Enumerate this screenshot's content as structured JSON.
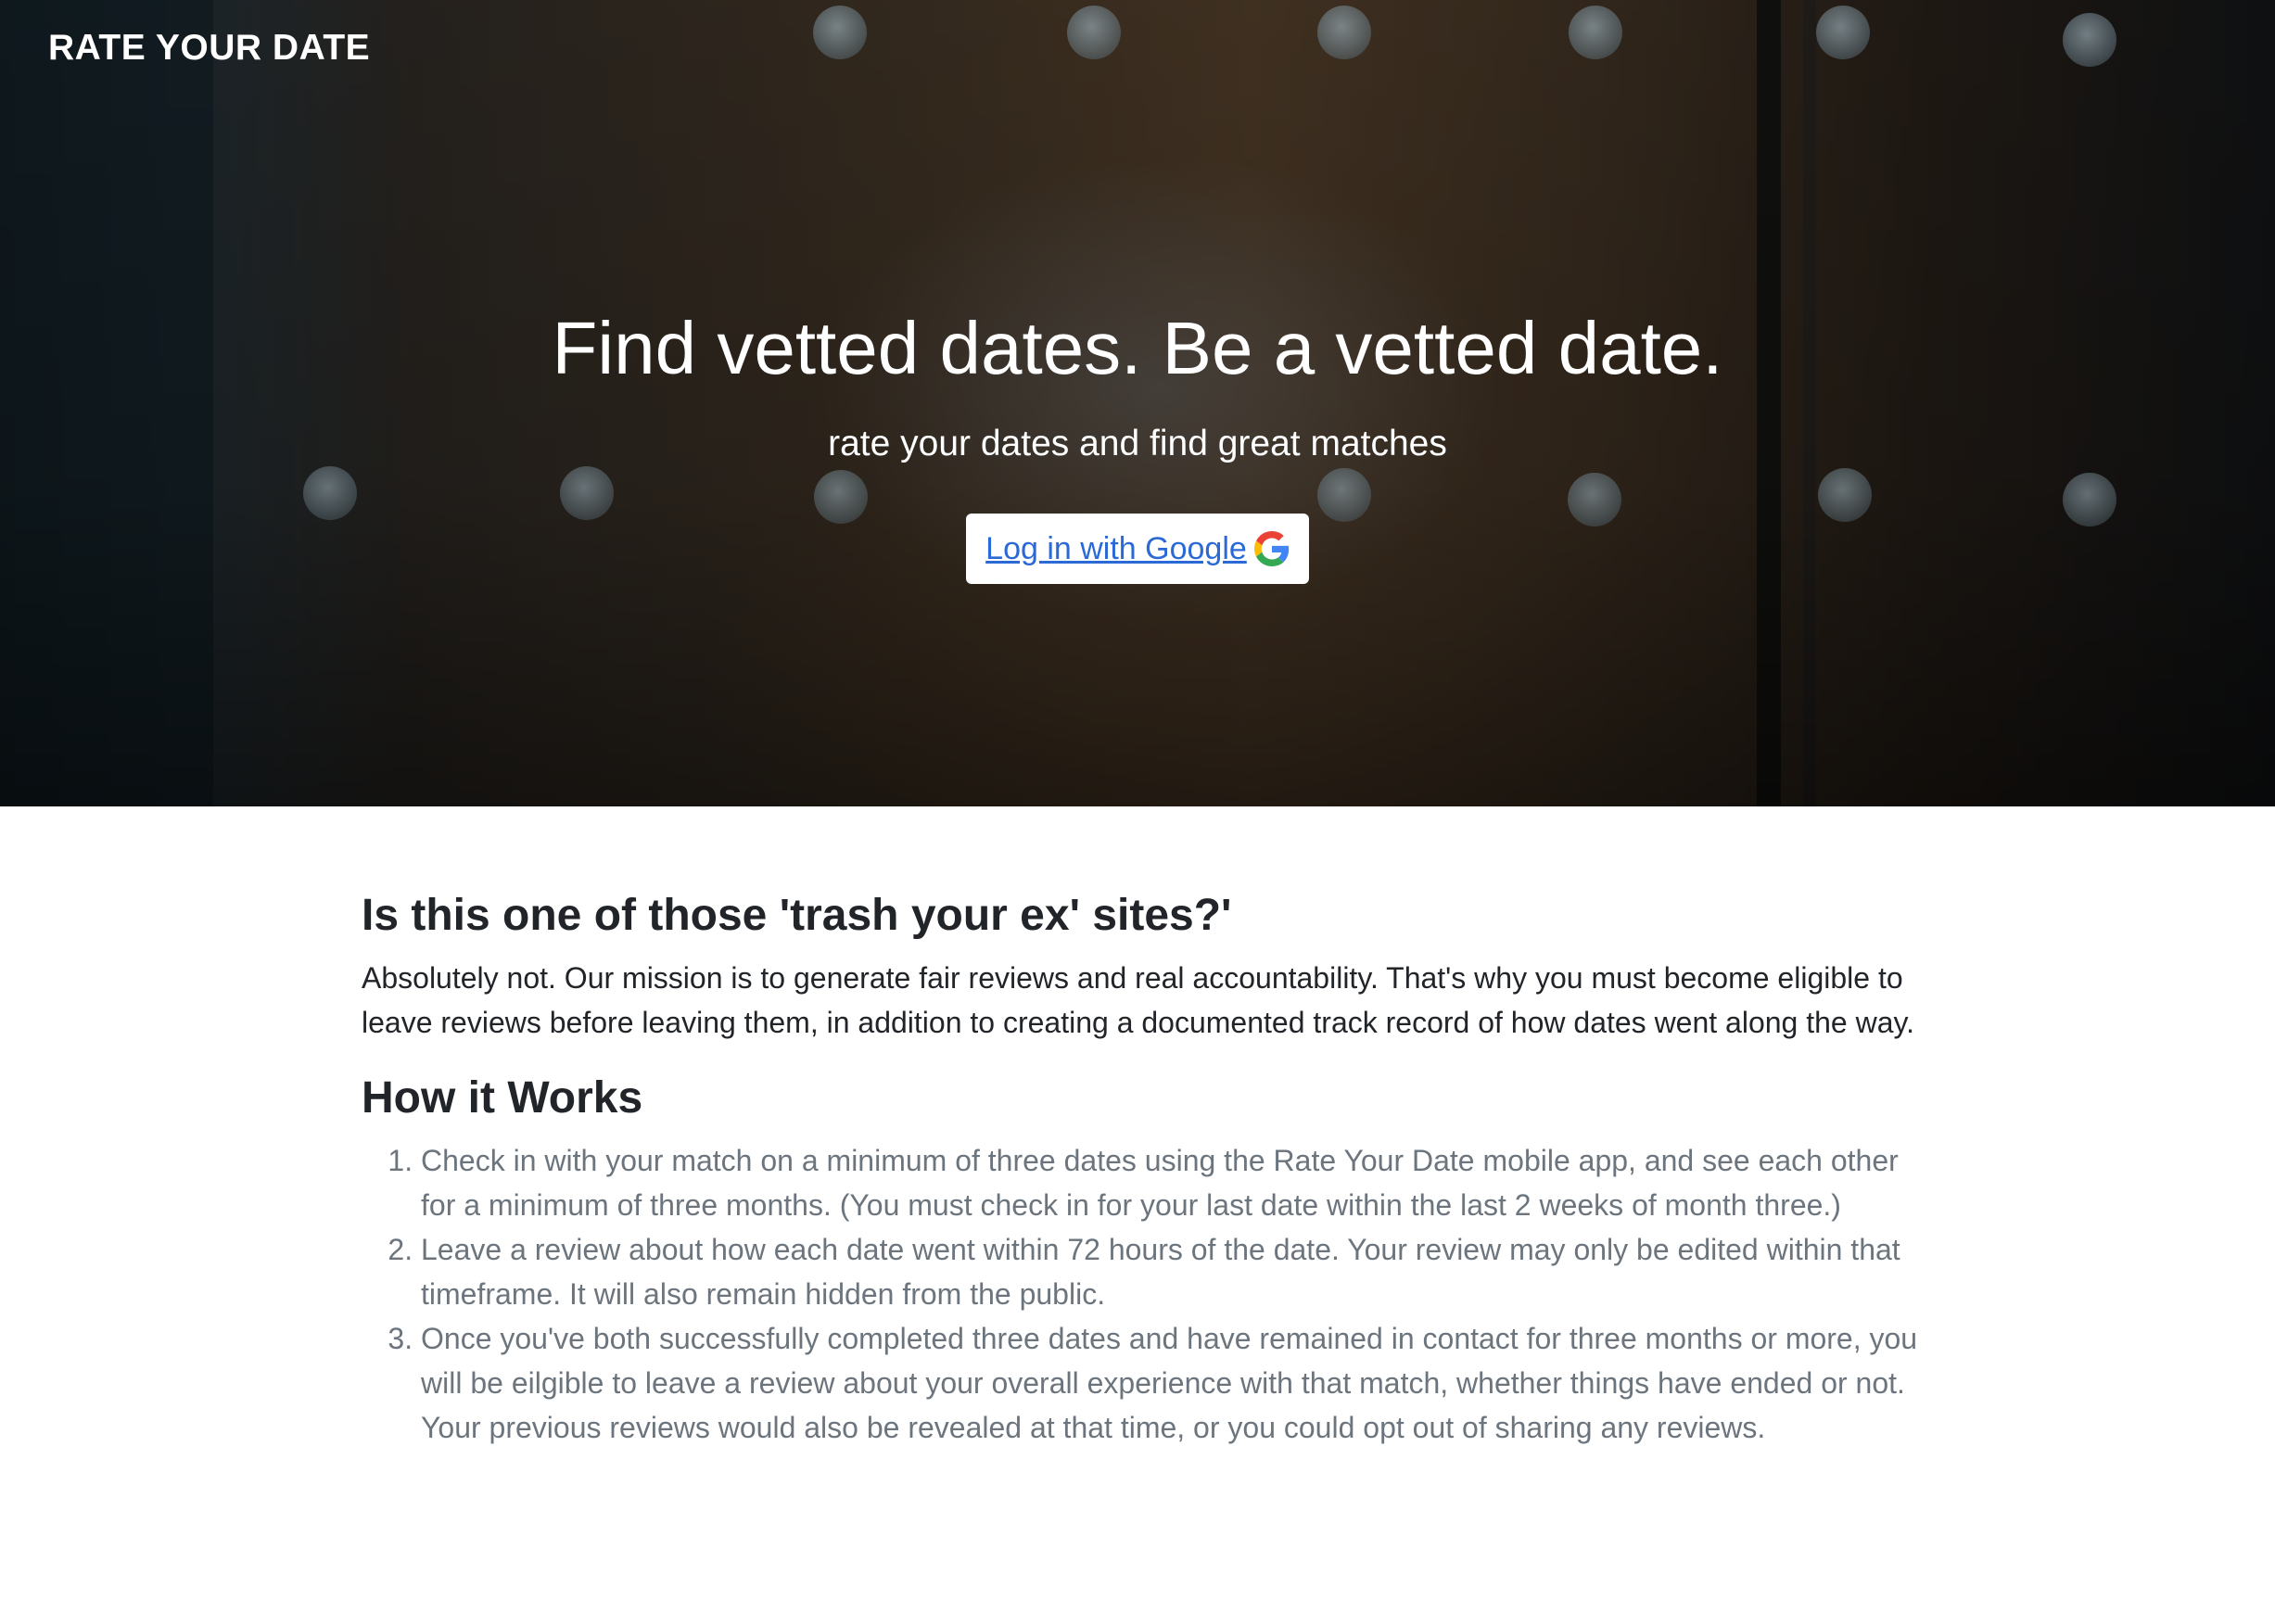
{
  "header": {
    "brand": "RATE YOUR DATE"
  },
  "hero": {
    "title": "Find vetted dates. Be a vetted date.",
    "subtitle": "rate your dates and find great matches",
    "login_label": "Log in with Google",
    "login_icon": "google-icon"
  },
  "faq": {
    "question": "Is this one of those 'trash your ex' sites?'",
    "answer": "Absolutely not. Our mission is to generate fair reviews and real accountability. That's why you must become eligible to leave reviews before leaving them, in addition to creating a documented track record of how dates went along the way."
  },
  "how_it_works": {
    "heading": "How it Works",
    "steps": [
      "Check in with your match on a minimum of three dates using the Rate Your Date mobile app, and see each other for a minimum of three months. (You must check in for your last date within the last 2 weeks of month three.)",
      "Leave a review about how each date went within 72 hours of the date. Your review may only be edited within that timeframe. It will also remain hidden from the public.",
      "Once you've both successfully completed three dates and have remained in contact for three months or more, you will be eilgible to leave a review about your overall experience with that match, whether things have ended or not. Your previous reviews would also be revealed at that time, or you could opt out of sharing any reviews."
    ]
  },
  "colors": {
    "link": "#2b6ad6",
    "heading": "#212529",
    "muted": "#6c757d"
  }
}
